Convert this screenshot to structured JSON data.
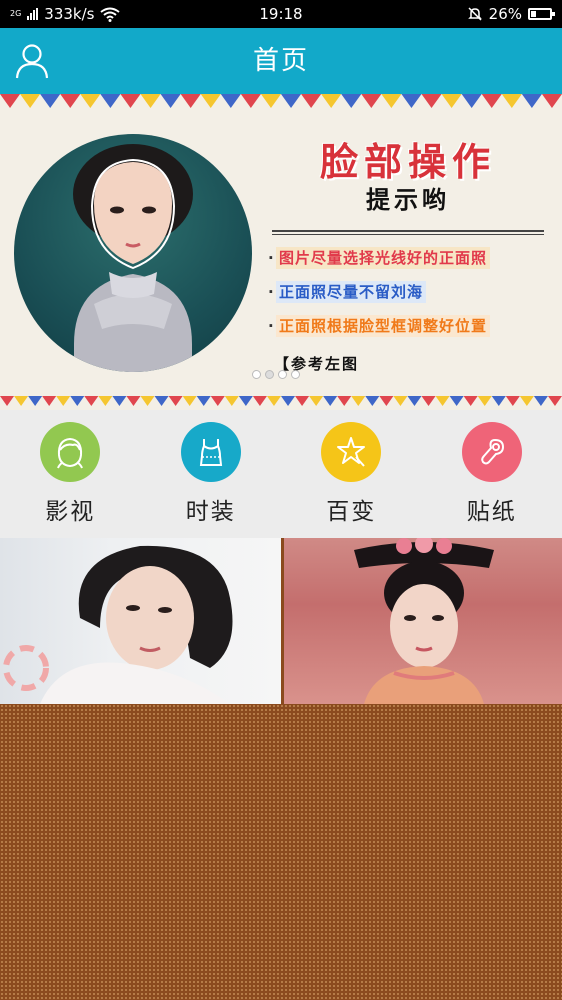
{
  "status_bar": {
    "network_type": "2G",
    "speed": "333k/s",
    "time": "19:18",
    "battery": "26%",
    "battery_level": 0.26
  },
  "header": {
    "title": "首页",
    "user_icon": "user-icon"
  },
  "banner": {
    "title": "脸部操作",
    "subtitle": "提示哟",
    "tips": [
      "图片尽量选择光线好的正面照",
      "正面照尽量不留刘海",
      "正面照根据脸型框调整好位置"
    ],
    "reference": "【参考左图",
    "page_count": 4,
    "active_page": 2
  },
  "categories": [
    {
      "label": "影视",
      "icon": "face-icon",
      "color": "#92c850"
    },
    {
      "label": "时装",
      "icon": "dress-icon",
      "color": "#17a9c9"
    },
    {
      "label": "百变",
      "icon": "star-icon",
      "color": "#f5c518"
    },
    {
      "label": "贴纸",
      "icon": "sticker-icon",
      "color": "#ef6478"
    }
  ],
  "colors": {
    "header_bg": "#12a9c9",
    "banner_bg": "#f3efe6",
    "category_bg": "#ececec",
    "fill_bg": "#8b4b1f"
  }
}
